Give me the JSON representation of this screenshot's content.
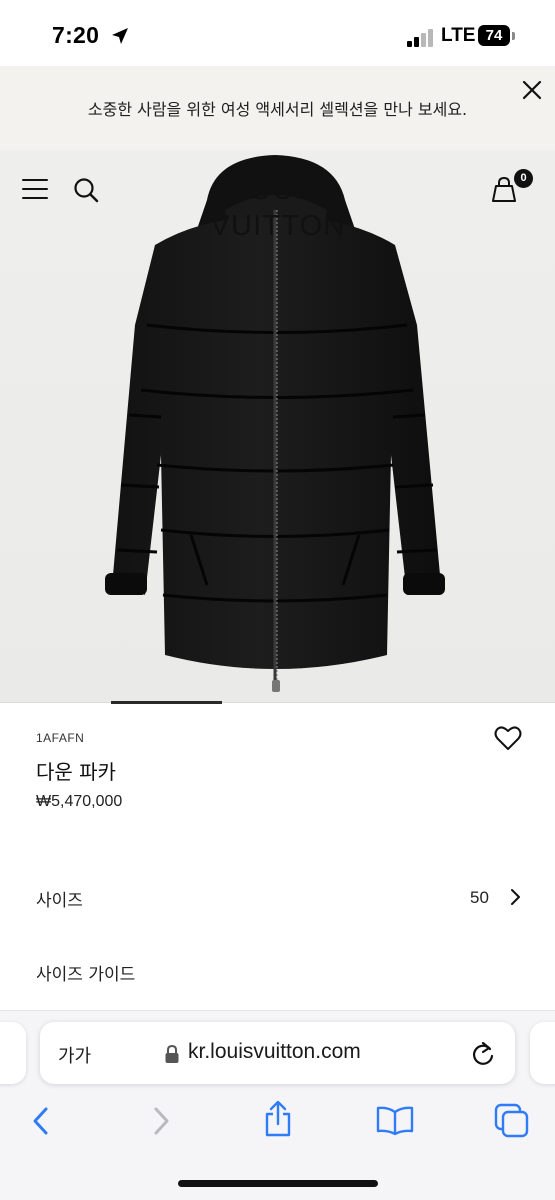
{
  "status_bar": {
    "time": "7:20",
    "network": "LTE",
    "battery": "74"
  },
  "promo": {
    "text": "소중한 사람을 위한 여성 액세서리 셀렉션을 만나 보세요."
  },
  "header": {
    "brand": "LOUIS VUITTON",
    "bag_count": "0"
  },
  "carousel": {
    "active_index": 1,
    "total_slides": 5
  },
  "product": {
    "code": "1AFAFN",
    "name": "다운 파카",
    "price": "₩5,470,000"
  },
  "options": {
    "size_label": "사이즈",
    "size_value": "50",
    "size_guide_label": "사이즈 가이드"
  },
  "browser": {
    "text_size_label": "가가",
    "url": "kr.louisvuitton.com"
  },
  "colors": {
    "accent_dark": "#111111",
    "promo_bg": "#f3f2ee",
    "hero_bg": "#ececea",
    "ios_blue": "#2f7cf6"
  }
}
